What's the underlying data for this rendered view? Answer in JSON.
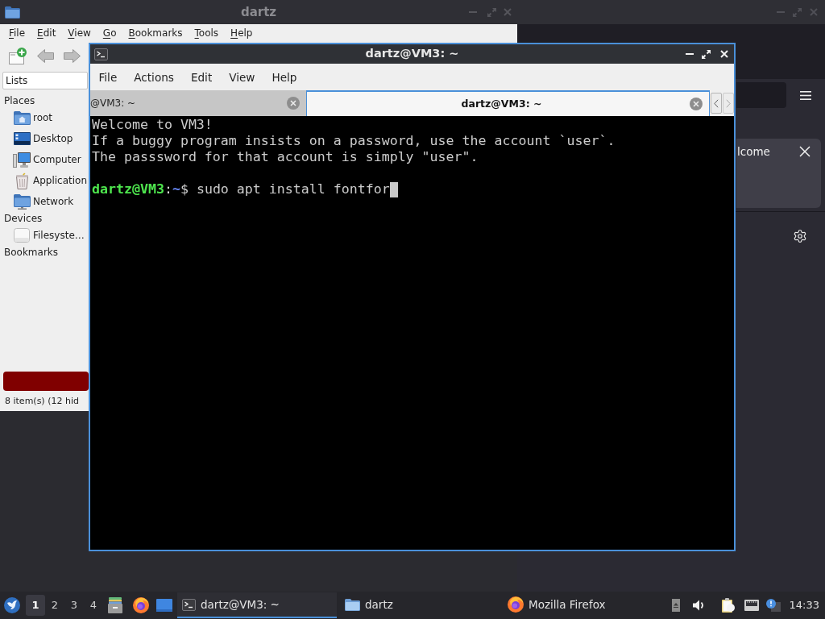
{
  "browser_window": {
    "focused": false,
    "card": {
      "title": "lcome"
    }
  },
  "file_manager": {
    "title": "dartz",
    "focused": false,
    "menu": [
      {
        "label": "File",
        "mnemonic": true
      },
      {
        "label": "Edit",
        "mnemonic": true
      },
      {
        "label": "View",
        "mnemonic": true
      },
      {
        "label": "Go",
        "mnemonic": true
      },
      {
        "label": "Bookmarks",
        "mnemonic": true
      },
      {
        "label": "Tools",
        "mnemonic": true
      },
      {
        "label": "Help",
        "mnemonic": true
      }
    ],
    "view_selector": "Lists",
    "sections": [
      {
        "title": "Places",
        "items": [
          {
            "label": "root",
            "kind": "home"
          },
          {
            "label": "Desktop",
            "kind": "desktop"
          },
          {
            "label": "Computer",
            "kind": "computer"
          },
          {
            "label": "Application",
            "kind": "applications"
          },
          {
            "label": "Network",
            "kind": "network"
          }
        ]
      },
      {
        "title": "Devices",
        "items": [
          {
            "label": "Filesyste…",
            "kind": "drive"
          }
        ]
      },
      {
        "title": "Bookmarks"
      }
    ],
    "status": "8 item(s) (12 hid"
  },
  "terminal": {
    "title": "dartz@VM3: ~",
    "focused": true,
    "menu": [
      "File",
      "Actions",
      "Edit",
      "View",
      "Help"
    ],
    "tabs": [
      {
        "label": "@VM3: ~",
        "selected": false
      },
      {
        "label": "dartz@VM3: ~",
        "selected": true
      }
    ],
    "output": [
      "Welcome to VM3!",
      "If a buggy program insists on a password, use the account `user`.",
      "The passsword for that account is simply \"user\"."
    ],
    "prompt": {
      "user_host": "dartz@VM3",
      "separator": ":",
      "path": "~",
      "input": "$ sudo apt install fontfor",
      "cursor": true
    }
  },
  "taskbar": {
    "workspaces": [
      {
        "label": "1",
        "selected": true
      },
      {
        "label": "2",
        "selected": false
      },
      {
        "label": "3",
        "selected": false
      },
      {
        "label": "4",
        "selected": false
      }
    ],
    "tasks": [
      {
        "label": "dartz@VM3: ~",
        "kind": "terminal",
        "selected": true
      },
      {
        "label": "dartz",
        "kind": "folder",
        "selected": false
      },
      {
        "label": "Mozilla Firefox",
        "kind": "firefox",
        "selected": false
      }
    ],
    "clock": "14:33"
  }
}
